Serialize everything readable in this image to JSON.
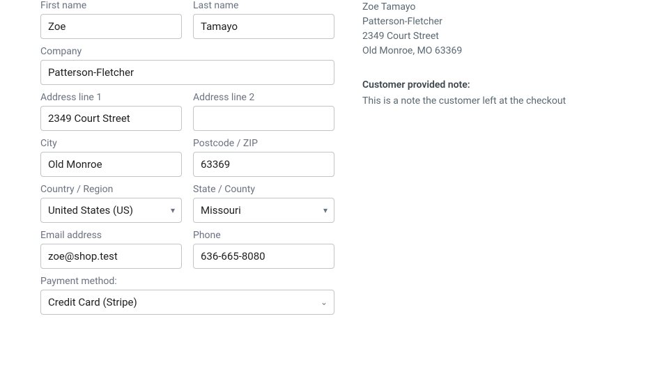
{
  "form": {
    "first_name_label": "First name",
    "first_name": "Zoe",
    "last_name_label": "Last name",
    "last_name": "Tamayo",
    "company_label": "Company",
    "company": "Patterson-Fletcher",
    "address1_label": "Address line 1",
    "address1": "2349 Court Street",
    "address2_label": "Address line 2",
    "address2": "",
    "city_label": "City",
    "city": "Old Monroe",
    "postcode_label": "Postcode / ZIP",
    "postcode": "63369",
    "country_label": "Country / Region",
    "country": "United States (US)",
    "state_label": "State / County",
    "state": "Missouri",
    "email_label": "Email address",
    "email": "zoe@shop.test",
    "phone_label": "Phone",
    "phone": "636-665-8080",
    "payment_label": "Payment method:",
    "payment": "Credit Card (Stripe)"
  },
  "summary": {
    "name": "Zoe Tamayo",
    "company": "Patterson-Fletcher",
    "street": "2349 Court Street",
    "citystatezip": "Old Monroe, MO 63369",
    "note_heading": "Customer provided note:",
    "note_text": "This is a note the customer left at the checkout"
  }
}
